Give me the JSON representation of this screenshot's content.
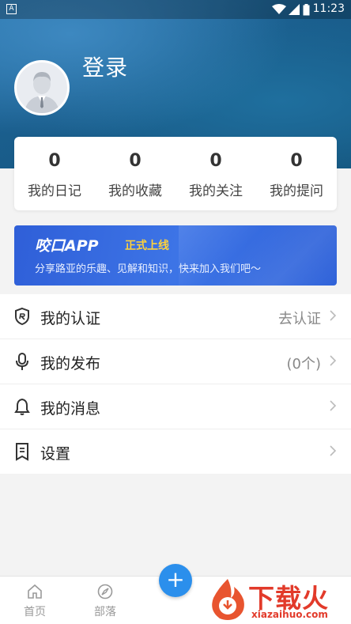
{
  "status_bar": {
    "time": "11:23",
    "badge": "A"
  },
  "profile": {
    "login_label": "登录"
  },
  "stats": [
    {
      "count": "0",
      "label": "我的日记"
    },
    {
      "count": "0",
      "label": "我的收藏"
    },
    {
      "count": "0",
      "label": "我的关注"
    },
    {
      "count": "0",
      "label": "我的提问"
    }
  ],
  "banner": {
    "title": "咬口APP",
    "tag": "正式上线",
    "subtitle": "分享路亚的乐趣、见解和知识，快来加入我们吧～"
  },
  "menu": [
    {
      "icon": "shield-icon",
      "label": "我的认证",
      "value": "去认证"
    },
    {
      "icon": "microphone-icon",
      "label": "我的发布",
      "value": "(0个)"
    },
    {
      "icon": "bell-icon",
      "label": "我的消息",
      "value": ""
    },
    {
      "icon": "bookmark-icon",
      "label": "设置",
      "value": ""
    }
  ],
  "tabbar": {
    "home": "首页",
    "tribe": "部落",
    "fab": "+"
  },
  "watermark": {
    "text": "下载火",
    "url": "xiazaihuo.com"
  },
  "colors": {
    "accent": "#2b8fec",
    "banner": "#3d74e6",
    "tag": "#ffd23a",
    "watermark": "#e23a2a"
  }
}
